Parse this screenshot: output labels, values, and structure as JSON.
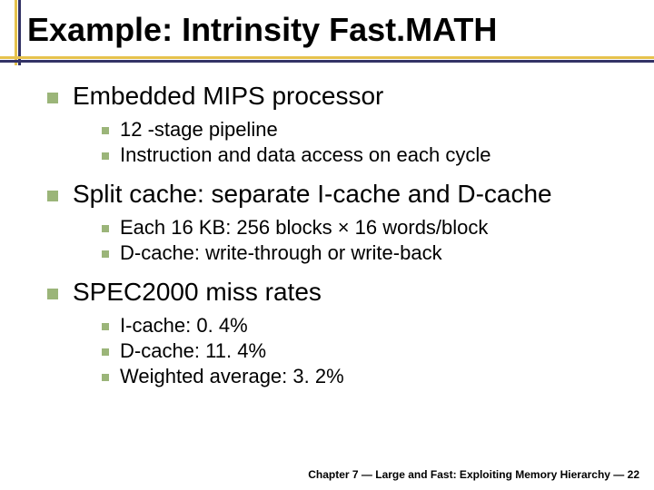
{
  "title": "Example: Intrinsity Fast.MATH",
  "bullets": [
    {
      "text": "Embedded MIPS processor",
      "sub": [
        "12 -stage pipeline",
        "Instruction and data access on each cycle"
      ]
    },
    {
      "text": "Split cache: separate I-cache and D-cache",
      "sub": [
        "Each 16 KB: 256 blocks × 16 words/block",
        "D-cache: write-through or write-back"
      ]
    },
    {
      "text": "SPEC2000 miss rates",
      "sub": [
        "I-cache: 0. 4%",
        "D-cache: 11. 4%",
        "Weighted average: 3. 2%"
      ]
    }
  ],
  "footer": "Chapter 7 — Large and Fast: Exploiting Memory Hierarchy — 22"
}
